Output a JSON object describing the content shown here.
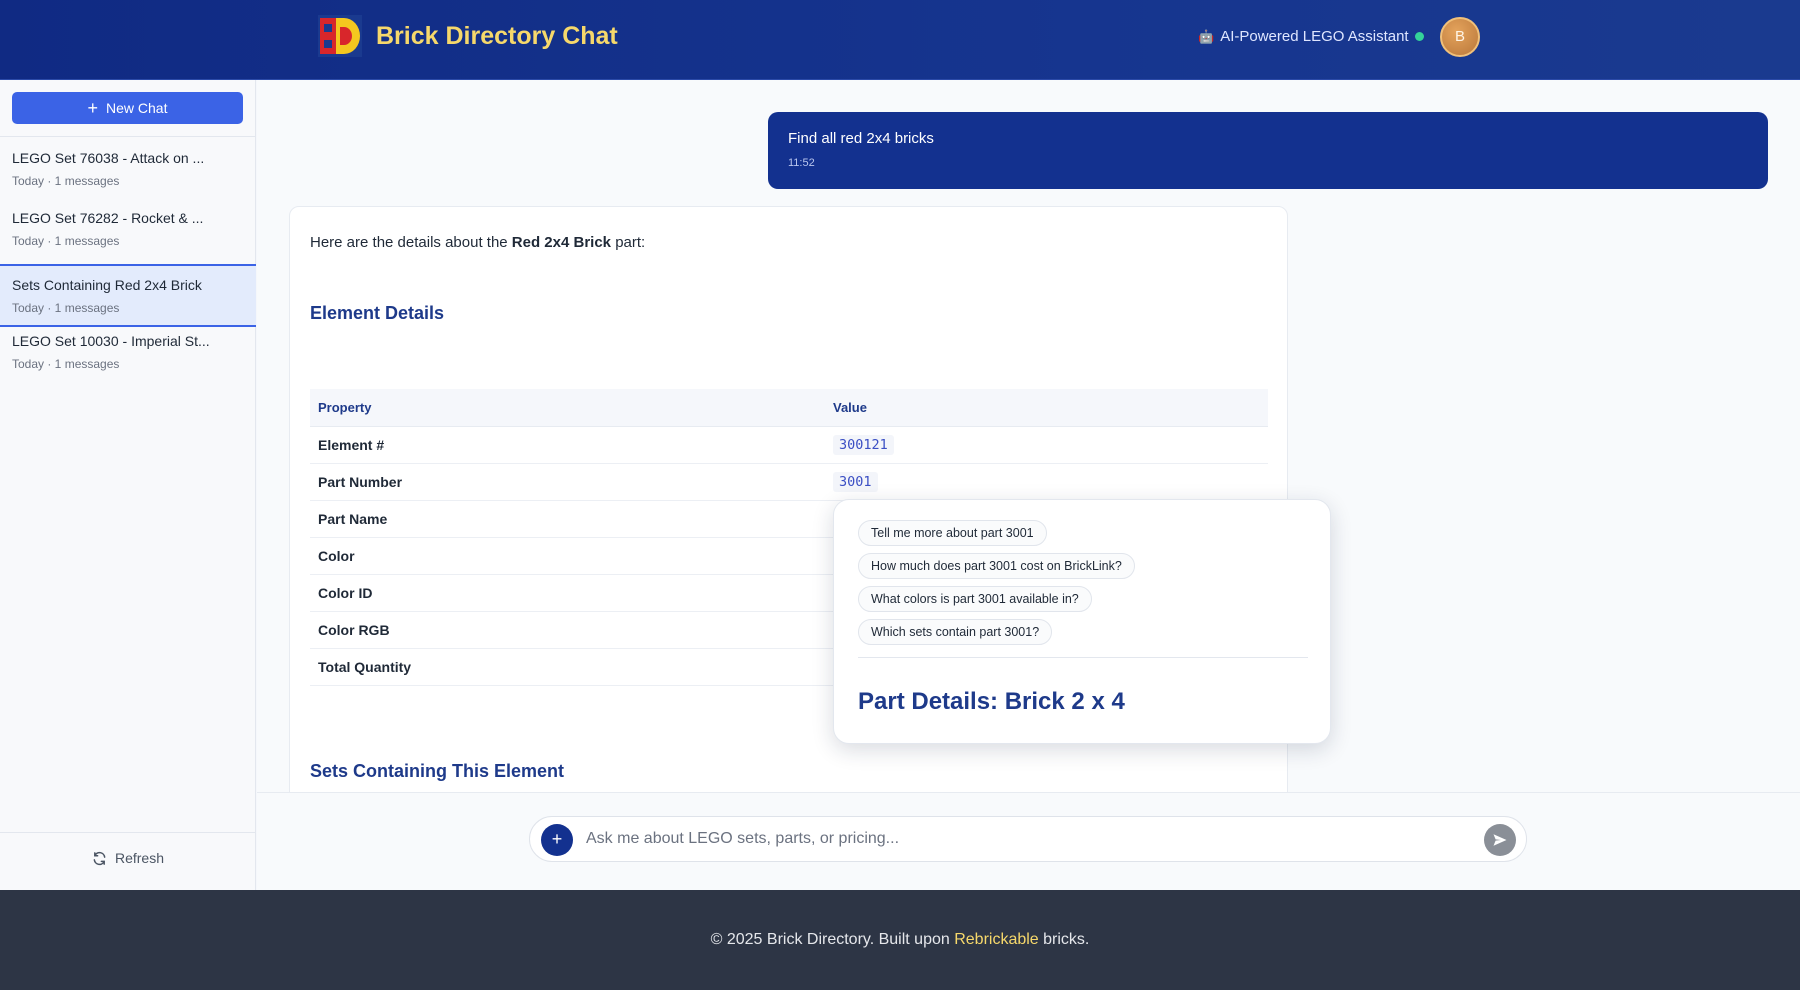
{
  "header": {
    "app_title": "Brick Directory Chat",
    "assistant_label": "AI-Powered LEGO Assistant",
    "avatar_initial": "B"
  },
  "sidebar": {
    "new_chat_label": "New Chat",
    "chats": [
      {
        "title": "LEGO Set 76038 - Attack on ...",
        "meta": "Today · 1 messages"
      },
      {
        "title": "LEGO Set 76282 - Rocket & ...",
        "meta": "Today · 1 messages"
      },
      {
        "title": "Sets Containing Red 2x4 Brick",
        "meta": "Today · 1 messages",
        "active": true
      },
      {
        "title": "LEGO Set 10030 - Imperial St...",
        "meta": "Today · 1 messages"
      }
    ],
    "refresh_label": "Refresh"
  },
  "conversation": {
    "user_message": {
      "text": "Find all red 2x4 bricks",
      "time": "11:52"
    },
    "bot": {
      "intro_prefix": "Here are the details about the ",
      "intro_bold": "Red 2x4 Brick",
      "intro_suffix": " part:",
      "element_heading": "Element Details",
      "table_headers": [
        "Property",
        "Value"
      ],
      "rows": [
        {
          "property": "Element #",
          "value": "300121"
        },
        {
          "property": "Part Number",
          "value": "3001"
        },
        {
          "property": "Part Name",
          "value": ""
        },
        {
          "property": "Color",
          "value": ""
        },
        {
          "property": "Color ID",
          "value": ""
        },
        {
          "property": "Color RGB",
          "value": ""
        },
        {
          "property": "Total Quantity",
          "value": ""
        }
      ],
      "sets_heading": "Sets Containing This Element"
    }
  },
  "popover": {
    "suggestions": [
      "Tell me more about part 3001",
      "How much does part 3001 cost on BrickLink?",
      "What colors is part 3001 available in?",
      "Which sets contain part 3001?"
    ],
    "heading": "Part Details: Brick 2 x 4"
  },
  "input": {
    "placeholder": "Ask me about LEGO sets, parts, or pricing..."
  },
  "footer": {
    "prefix": "© 2025 Brick Directory. Built upon ",
    "link": "Rebrickable",
    "suffix": " bricks."
  },
  "colors": {
    "header_bg": "#13318f",
    "accent_blue": "#3b63e6",
    "title_yellow": "#f6d86b",
    "footer_bg": "#2d3545"
  }
}
